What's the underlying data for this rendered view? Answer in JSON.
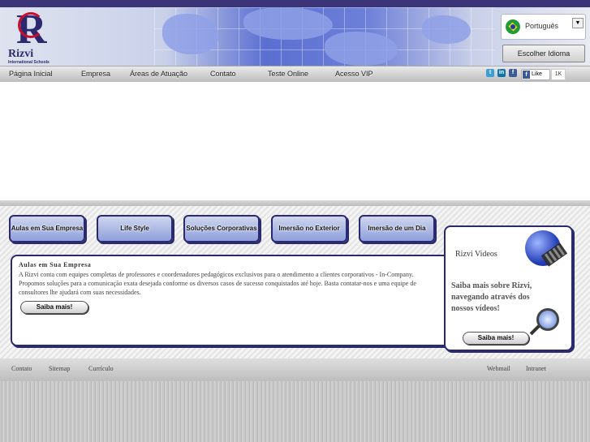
{
  "brand": {
    "name": "Rizvi",
    "subtitle": "International Schools"
  },
  "language": {
    "selected": "Português",
    "button": "Escolher Idioma"
  },
  "nav": {
    "items": [
      "Página Inicial",
      "Empresa",
      "Áreas de Atuação",
      "Contato",
      "Teste Online",
      "Acesso VIP"
    ]
  },
  "social": {
    "like_label": "Like",
    "like_count": "1K"
  },
  "tabs": [
    "Aulas em Sua Empresa",
    "Life Style",
    "Soluções Corporativas",
    "Imersão no Exterior",
    "Imersão de um Dia"
  ],
  "panel": {
    "title": "Aulas em Sua Empresa",
    "body": "A Rizvi conta com equipes completas de professores e coordenadores pedagógicos exclusivos para o atendimento a clientes corporativos - In-Company. Propomos soluções para a comunicação exata desejada conforme os diversos casos de sucesso conquistados até hoje. Basta contatar-nos e uma equipe de consultores lhe ajudará com suas necessidades.",
    "button": "Saiba mais!"
  },
  "videos": {
    "title": "Rizvi Videos",
    "body": "Saiba mais sobre Rizvi, navegando através dos nossos vídeos!",
    "button": "Saiba mais!"
  },
  "footer": {
    "left": [
      "Contato",
      "Sitemap",
      "Currículo"
    ],
    "right": [
      "Webmail",
      "Intranet"
    ]
  }
}
